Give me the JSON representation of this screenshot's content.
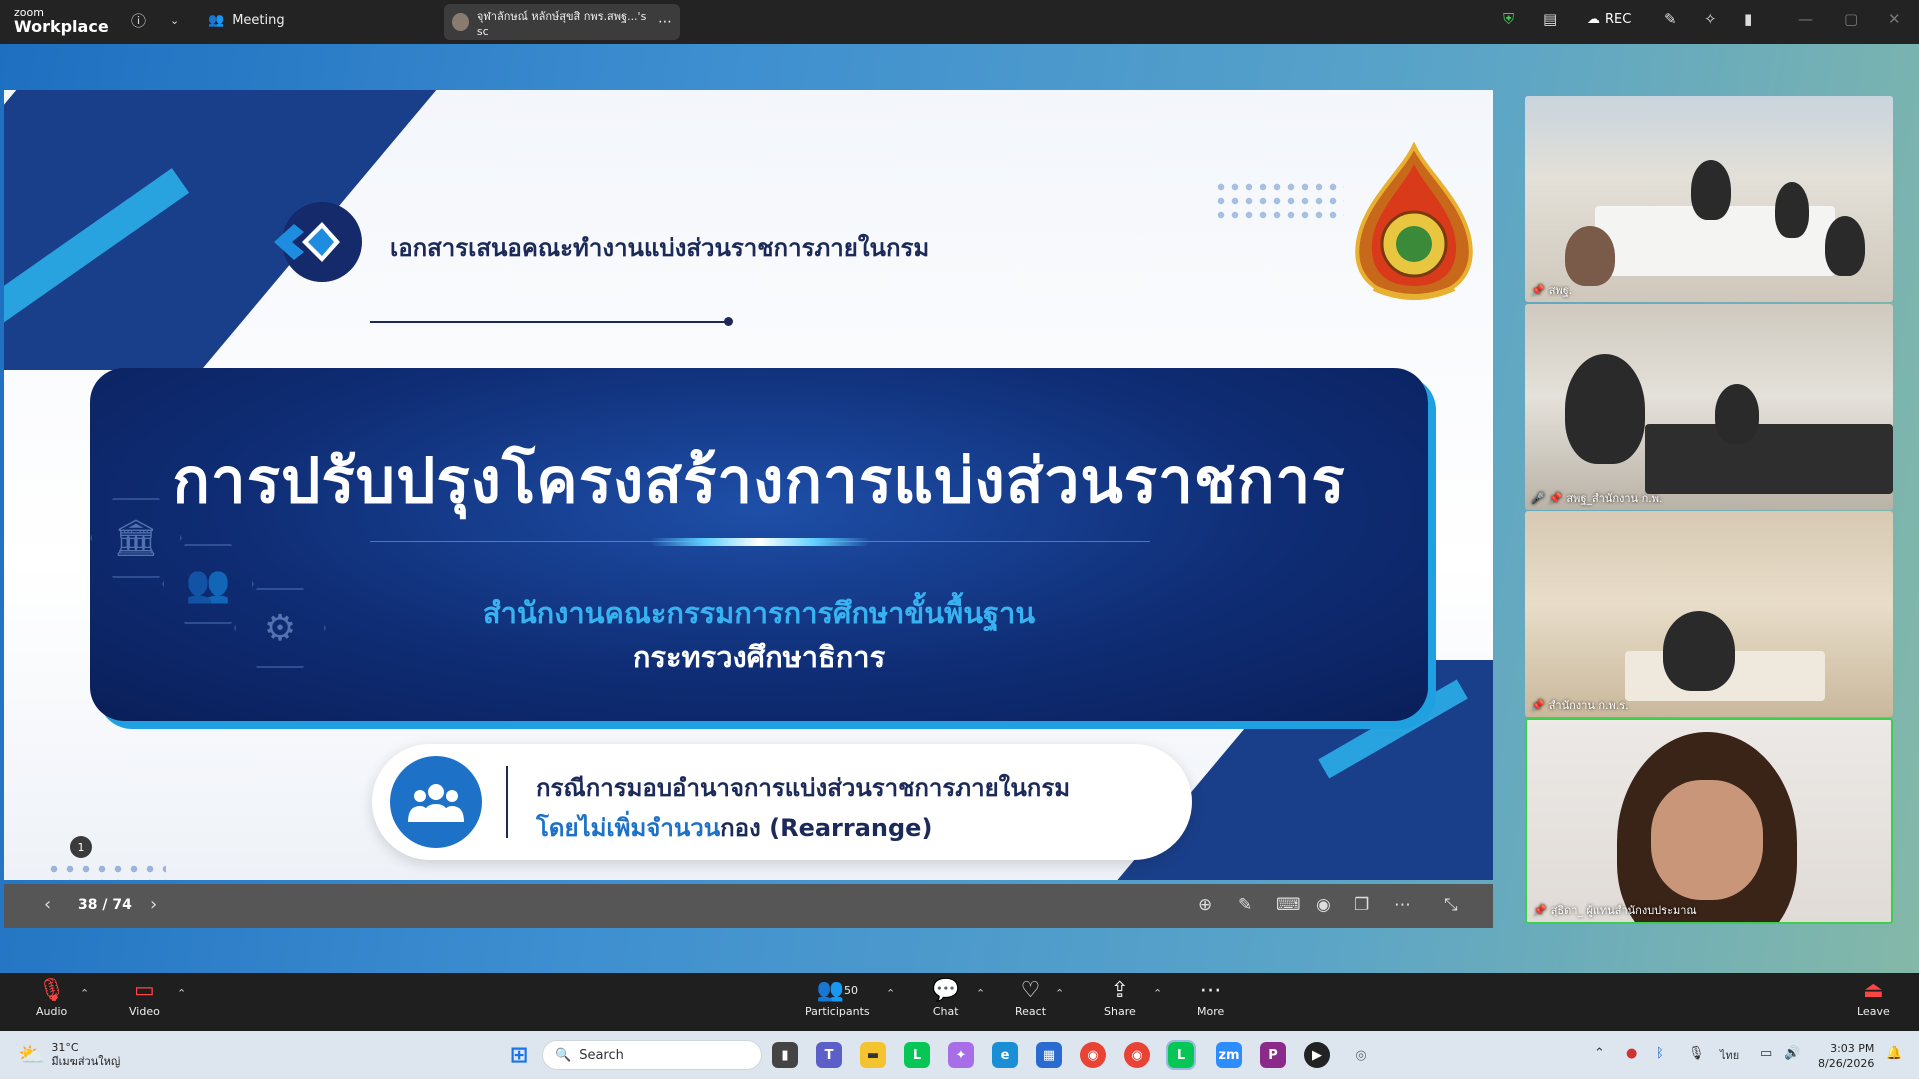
{
  "app": {
    "logo_small": "zoom",
    "logo_big": "Workplace"
  },
  "topbar": {
    "meeting_label": "Meeting",
    "share_pill_text": "จุฬาลักษณ์ หลักษ์สุขสิ กพร.สพฐ...'s sc",
    "rec_label": "REC"
  },
  "slide": {
    "header_text": "เอกสารเสนอคณะทำงานแบ่งส่วนราชการภายในกรม",
    "main_title": "การปรับปรุงโครงสร้างการแบ่งส่วนราชการ",
    "subtitle_1": "สำนักงานคณะกรรมการการศึกษาขั้นพื้นฐาน",
    "subtitle_2": "กระทรวงศึกษาธิการ",
    "pill_line_1": "กรณีการมอบอำนาจการแบ่งส่วนราชการภายในกรม",
    "pill_line_2_blue": "โดยไม่เพิ่มจำนวน",
    "pill_line_2_dark": "กอง (Rearrange)",
    "page_badge": "1"
  },
  "slide_controls": {
    "page_indicator": "38 / 74"
  },
  "videos": [
    {
      "name": "สพฐ."
    },
    {
      "name": "สพฐ_สำนักงาน ก.พ."
    },
    {
      "name": "สำนักงาน ก.พ.ร."
    },
    {
      "name": "สุธิดา_ ผู้แทนสำนักงบประมาณ"
    }
  ],
  "bottombar": {
    "audio": "Audio",
    "video": "Video",
    "participants": "Participants",
    "participants_count": "50",
    "chat": "Chat",
    "react": "React",
    "share": "Share",
    "more": "More",
    "leave": "Leave"
  },
  "taskbar": {
    "weather_temp": "31°C",
    "weather_desc": "มีเมฆส่วนใหญ่",
    "search_placeholder": "Search",
    "lang": "ไทย",
    "time": "3:03 PM",
    "date": "8/26/2026"
  },
  "colors": {
    "accent_blue": "#1d72c7",
    "banner_navy": "#0f2d75",
    "active_speaker": "#3ccf4e"
  }
}
